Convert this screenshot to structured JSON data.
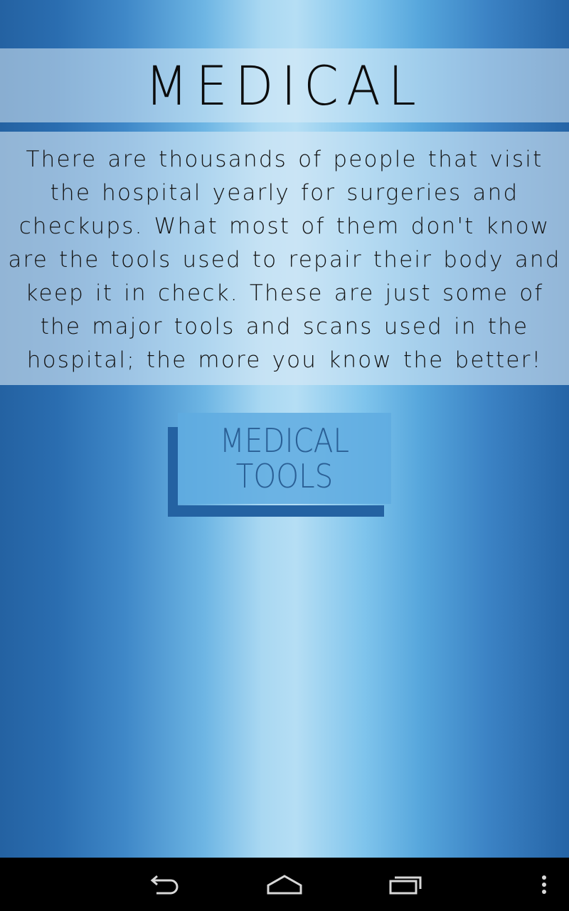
{
  "header": {
    "title": "MEDICAL"
  },
  "intro": {
    "text": "There are thousands of people that visit the hospital yearly for surgeries and checkups. What most of them don't know are the tools used to repair their body and keep it in check. These are just some of the major tools and scans used in the hospital; the more you know the better!"
  },
  "tools_button": {
    "line1": "MEDICAL",
    "line2": "TOOLS"
  },
  "nav": {
    "icons": [
      "back-icon",
      "home-icon",
      "recent-apps-icon",
      "overflow-menu-icon"
    ]
  },
  "colors": {
    "accent_dark_blue": "#2462a2",
    "button_fill": "#5faee0",
    "nav_bar": "#000000"
  }
}
